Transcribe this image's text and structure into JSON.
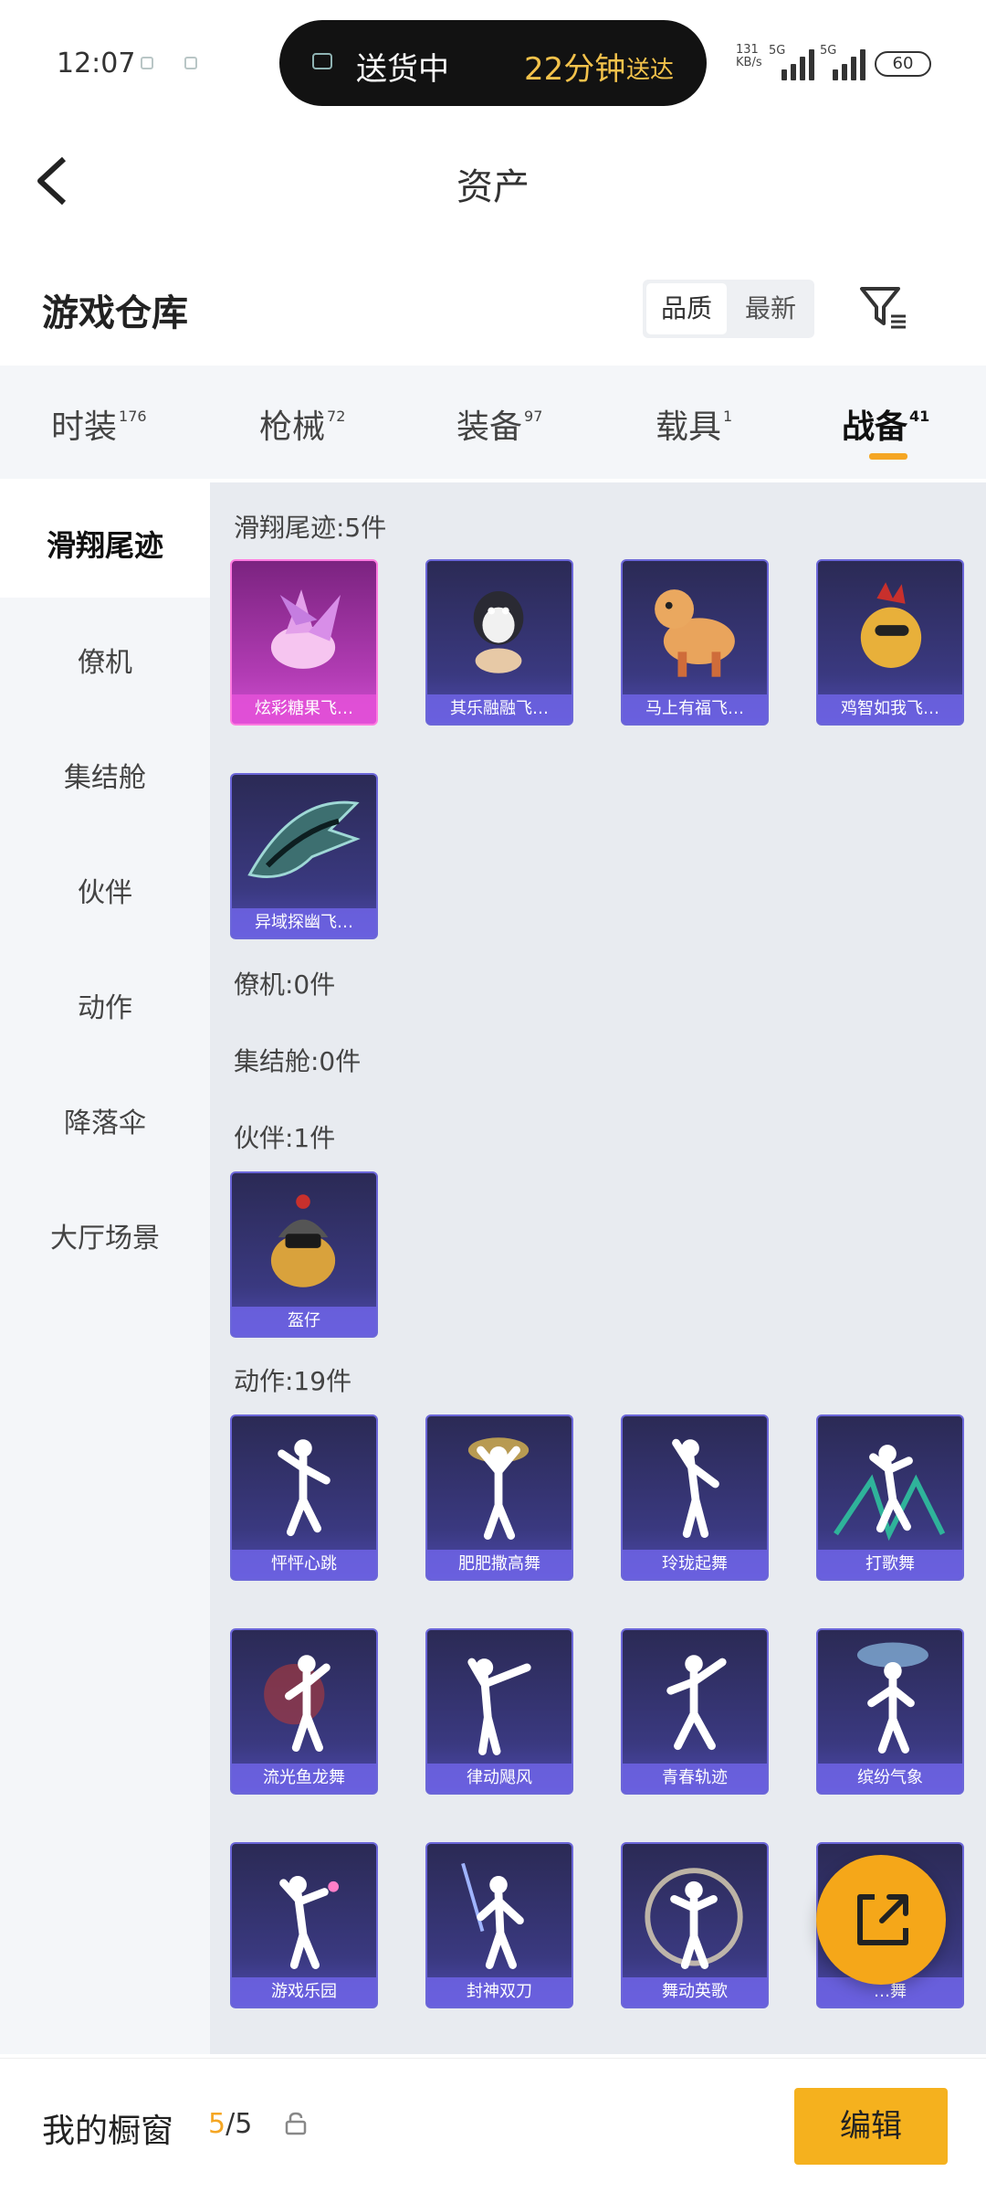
{
  "status_bar": {
    "time": "12:07",
    "live_activity": {
      "label": "送货中",
      "minutes": "22分钟",
      "suffix": "送达"
    },
    "network_speed": "131\nKB/s",
    "signal1": "5G",
    "signal2": "5G",
    "battery": "60"
  },
  "header": {
    "title": "资产"
  },
  "warehouse": {
    "title": "游戏仓库",
    "sort_options": [
      "品质",
      "最新"
    ],
    "selected_sort": "品质"
  },
  "tabs": [
    {
      "label": "时装",
      "count": "176"
    },
    {
      "label": "枪械",
      "count": "72"
    },
    {
      "label": "装备",
      "count": "97"
    },
    {
      "label": "载具",
      "count": "1"
    },
    {
      "label": "战备",
      "count": "41",
      "active": true
    }
  ],
  "sidebar": {
    "items": [
      "滑翔尾迹",
      "僚机",
      "集结舱",
      "伙伴",
      "动作",
      "降落伞",
      "大厅场景"
    ],
    "active": "滑翔尾迹"
  },
  "sections": [
    {
      "title": "滑翔尾迹:5件",
      "items": [
        "炫彩糖果飞…",
        "其乐融融飞…",
        "马上有福飞…",
        "鸡智如我飞…",
        "异域探幽飞…"
      ]
    },
    {
      "title": "僚机:0件",
      "items": []
    },
    {
      "title": "集结舱:0件",
      "items": []
    },
    {
      "title": "伙伴:1件",
      "items": [
        "盔仔"
      ]
    },
    {
      "title": "动作:19件",
      "items": [
        "怦怦心跳",
        "肥肥撒高舞",
        "玲珑起舞",
        "打歌舞",
        "流光鱼龙舞",
        "律动飓风",
        "青春轨迹",
        "缤纷气象",
        "游戏乐园",
        "封神双刀",
        "舞动英歌",
        "…舞"
      ]
    }
  ],
  "bottom_bar": {
    "label": "我的橱窗",
    "count_current": "5",
    "count_total": "/5",
    "edit_label": "编辑"
  },
  "colors": {
    "accent": "#f5a623",
    "card_purple": "#3a3980",
    "card_pink": "#b23cb4"
  },
  "icons": [
    "back-arrow-icon",
    "filter-icon",
    "lock-icon",
    "share-icon"
  ]
}
